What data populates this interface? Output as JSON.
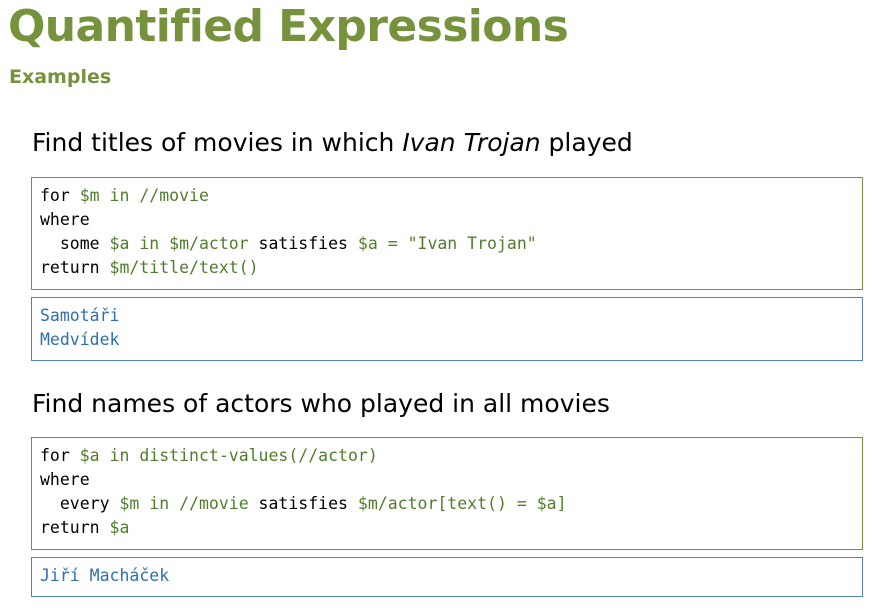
{
  "slide": {
    "title": "Quantified Expressions",
    "subtitle": "Examples"
  },
  "example1": {
    "heading_before": "Find titles of movies in which ",
    "heading_italic": "Ivan Trojan",
    "heading_after": " played",
    "code": [
      {
        "kw": "for ",
        "ex": "$m in //movie"
      },
      {
        "kw": "where",
        "ex": ""
      },
      {
        "kw": "  some ",
        "ex": "$a in $m/actor",
        "kw2": " satisfies ",
        "ex2": "$a = \"Ivan Trojan\""
      },
      {
        "kw": "return ",
        "ex": "$m/title/text()"
      }
    ],
    "output": [
      "Samotáři",
      "Medvídek"
    ]
  },
  "example2": {
    "heading": "Find names of actors who played in all movies",
    "code": [
      {
        "kw": "for ",
        "ex": "$a in distinct-values(//actor)"
      },
      {
        "kw": "where",
        "ex": ""
      },
      {
        "kw": "  every ",
        "ex": "$m in //movie",
        "kw2": " satisfies ",
        "ex2": "$m/actor[text() = $a]"
      },
      {
        "kw": "return ",
        "ex": "$a"
      }
    ],
    "output": [
      "Jiří Macháček"
    ]
  },
  "colors": {
    "accent_green": "#76923c",
    "code_green": "#4f7d2c",
    "output_blue": "#2e6fb0",
    "output_border": "#4f81bd"
  }
}
